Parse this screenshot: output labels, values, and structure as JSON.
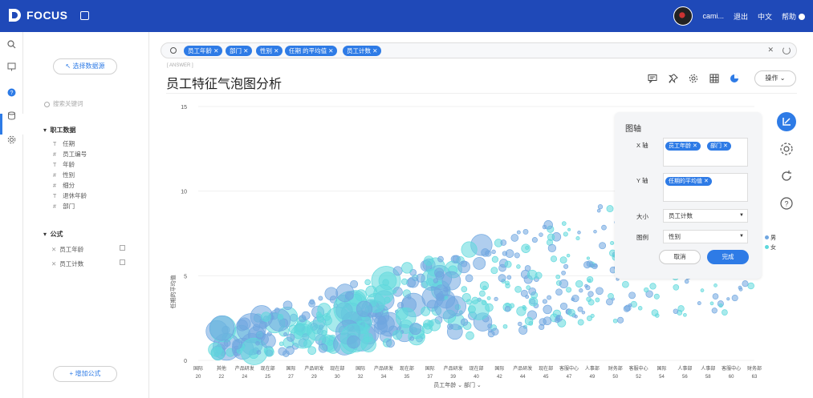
{
  "app": {
    "name": "FOCUS",
    "user": "cami...",
    "logout": "退出",
    "lang": "中文",
    "help": "帮助"
  },
  "sidebar": {
    "select_source": "选择数据源",
    "search_placeholder": "搜索关键词",
    "group_title": "职工数据",
    "fields": [
      {
        "type": "T",
        "label": "任期"
      },
      {
        "type": "#",
        "label": "员工编号"
      },
      {
        "type": "T",
        "label": "年龄"
      },
      {
        "type": "#",
        "label": "性别"
      },
      {
        "type": "#",
        "label": "细分"
      },
      {
        "type": "T",
        "label": "退休年龄"
      },
      {
        "type": "#",
        "label": "部门"
      }
    ],
    "formula_title": "公式",
    "formulas": [
      "员工年龄",
      "员工计数"
    ],
    "add_formula": "增加公式"
  },
  "search": {
    "chips": [
      "员工年龄",
      "部门",
      "性别",
      "任期 的平均值",
      "员工计数"
    ]
  },
  "answer": {
    "label": "ANSWER",
    "title": "员工特征气泡图分析",
    "operate": "操作"
  },
  "axis_panel": {
    "title": "图轴",
    "x_label": "X 轴",
    "x_chips": [
      "员工年龄",
      "部门"
    ],
    "y_label": "Y 轴",
    "y_chips": [
      "任期的平均值"
    ],
    "size_label": "大小",
    "size_value": "员工计数",
    "legend_label": "图例",
    "legend_value": "性别",
    "cancel": "取消",
    "done": "完成"
  },
  "legend": [
    "男",
    "女"
  ],
  "colors": {
    "brand": "#1f49b8",
    "accent": "#2e7be6",
    "male": "#6fa6e0",
    "female": "#5ed8dc"
  },
  "chart_data": {
    "type": "scatter",
    "subtype": "bubble",
    "ylabel": "任期的平均值",
    "xlabel": "员工年龄",
    "xlabel2": "部门",
    "ylim": [
      0,
      15
    ],
    "yticks": [
      0,
      5,
      10,
      15
    ],
    "x_categories": [
      {
        "dept": "国际",
        "age": "20"
      },
      {
        "dept": "其他",
        "age": "22"
      },
      {
        "dept": "产品研发",
        "age": "24"
      },
      {
        "dept": "现在部",
        "age": "25"
      },
      {
        "dept": "国际",
        "age": "27"
      },
      {
        "dept": "产品研发",
        "age": "29"
      },
      {
        "dept": "现在部",
        "age": "30"
      },
      {
        "dept": "国际",
        "age": "32"
      },
      {
        "dept": "产品研发",
        "age": "34"
      },
      {
        "dept": "现在部",
        "age": "35"
      },
      {
        "dept": "国际",
        "age": "37"
      },
      {
        "dept": "产品研发",
        "age": "39"
      },
      {
        "dept": "现在部",
        "age": "40"
      },
      {
        "dept": "国际",
        "age": "42"
      },
      {
        "dept": "产品研发",
        "age": "44"
      },
      {
        "dept": "现在部",
        "age": "45"
      },
      {
        "dept": "客服中心",
        "age": "47"
      },
      {
        "dept": "人事部",
        "age": "49"
      },
      {
        "dept": "财务部",
        "age": "50"
      },
      {
        "dept": "客服中心",
        "age": "52"
      },
      {
        "dept": "国际",
        "age": "54"
      },
      {
        "dept": "人事部",
        "age": "56"
      },
      {
        "dept": "人事部",
        "age": "58"
      },
      {
        "dept": "客服中心",
        "age": "60"
      },
      {
        "dept": "财务部",
        "age": "63"
      }
    ],
    "series": [
      {
        "name": "男",
        "color": "#6fa6e0"
      },
      {
        "name": "女",
        "color": "#5ed8dc"
      }
    ]
  }
}
